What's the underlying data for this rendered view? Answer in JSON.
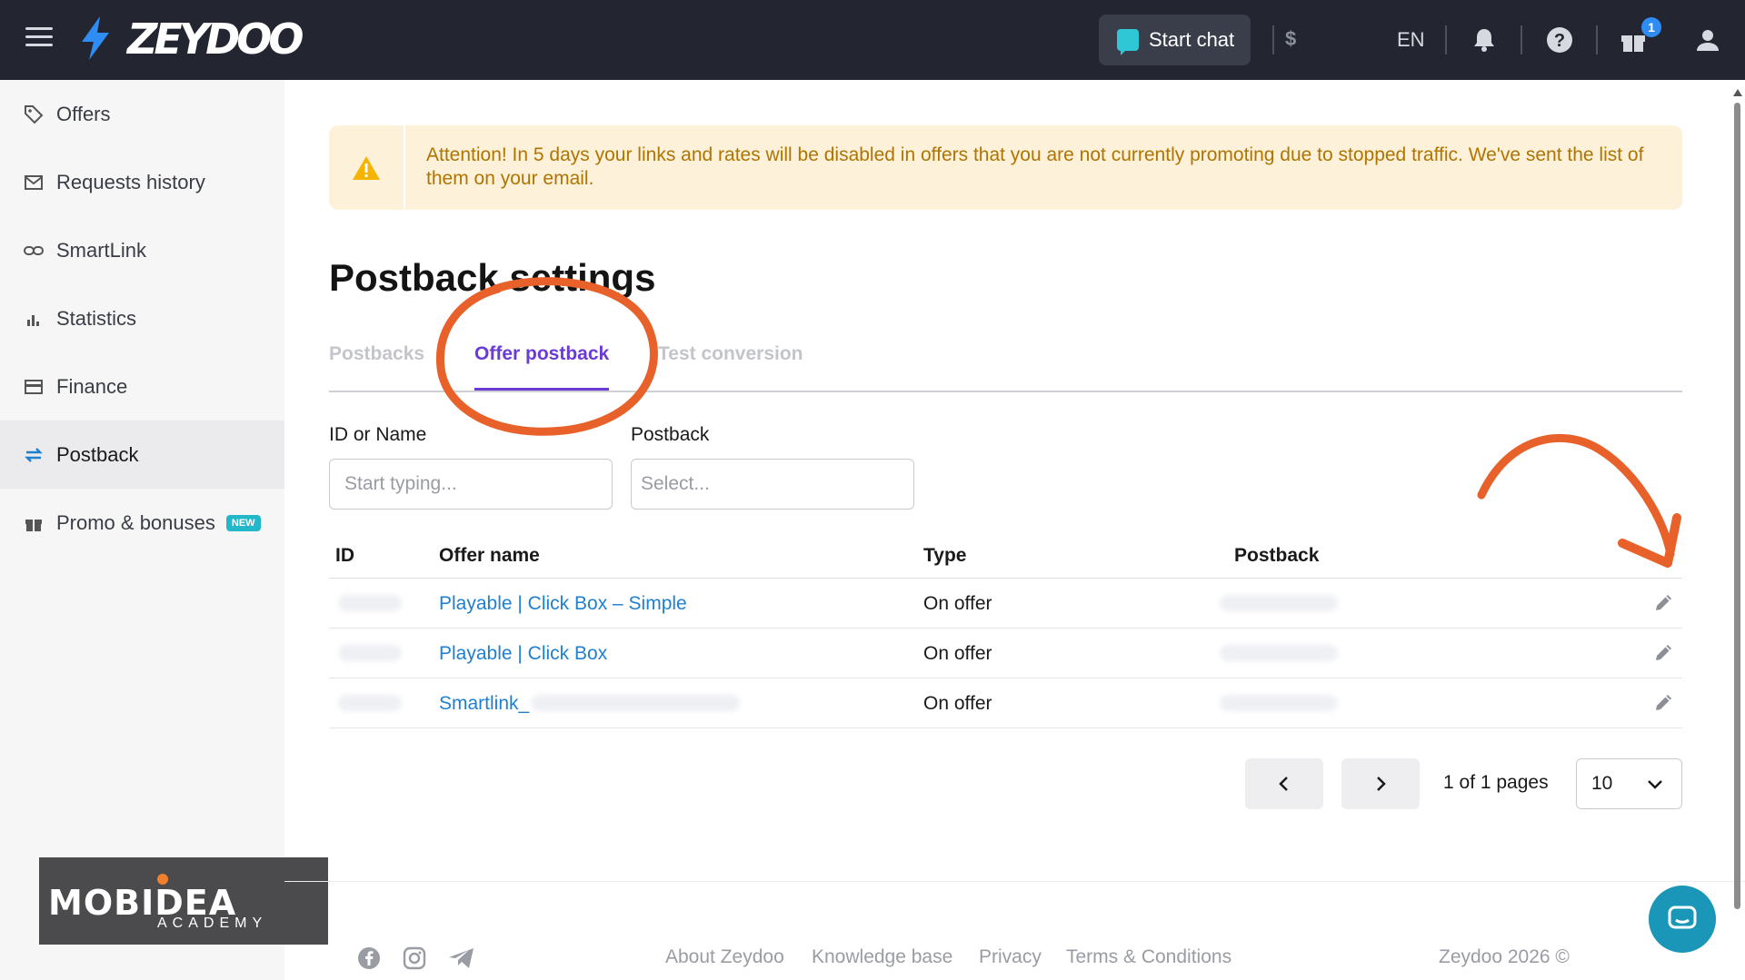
{
  "topbar": {
    "brand": "ZEYDOO",
    "start_chat_label": "Start chat",
    "balance_label": "$",
    "language": "EN",
    "gift_badge_count": "1"
  },
  "sidebar": {
    "items": [
      {
        "label": "Offers",
        "icon": "tag-icon"
      },
      {
        "label": "Requests history",
        "icon": "mail-icon"
      },
      {
        "label": "SmartLink",
        "icon": "link-icon"
      },
      {
        "label": "Statistics",
        "icon": "bar-chart-icon"
      },
      {
        "label": "Finance",
        "icon": "card-icon"
      },
      {
        "label": "Postback",
        "icon": "swap-arrows-icon",
        "active": true
      },
      {
        "label": "Promo & bonuses",
        "icon": "gift-icon",
        "badge": "NEW"
      }
    ]
  },
  "alert": {
    "message": "Attention! In 5 days your links and rates will be disabled in offers that you are not currently promoting due to stopped traffic. We've sent the list of them on your email."
  },
  "page": {
    "title": "Postback settings",
    "tabs": [
      {
        "label": "Postbacks"
      },
      {
        "label": "Offer postback",
        "active": true
      },
      {
        "label": "Test conversion"
      }
    ]
  },
  "filters": {
    "id_label": "ID or Name",
    "id_placeholder": "Start typing...",
    "postback_label": "Postback",
    "postback_placeholder": "Select..."
  },
  "table": {
    "headers": {
      "id": "ID",
      "offer_name": "Offer name",
      "type": "Type",
      "postback": "Postback"
    },
    "rows": [
      {
        "offer_name": "Playable | Click Box – Simple",
        "type": "On offer"
      },
      {
        "offer_name": "Playable | Click Box",
        "type": "On offer"
      },
      {
        "offer_name": "Smartlink_",
        "type": "On offer"
      }
    ]
  },
  "pagination": {
    "page_text": "1 of 1 pages",
    "page_size": "10"
  },
  "footer": {
    "links": [
      "About Zeydoo",
      "Knowledge base",
      "Privacy",
      "Terms & Conditions"
    ],
    "copyright": "Zeydoo 2026 ©"
  },
  "watermark": {
    "brand": "MOBIDEA",
    "sub": "ACADEMY"
  },
  "colors": {
    "topbar_bg": "#232631",
    "accent_purple": "#6b3bd6",
    "link_blue": "#1f7fd1",
    "alert_bg": "#fdf1da",
    "alert_text": "#b07400",
    "annotation_orange": "#e8612a"
  }
}
